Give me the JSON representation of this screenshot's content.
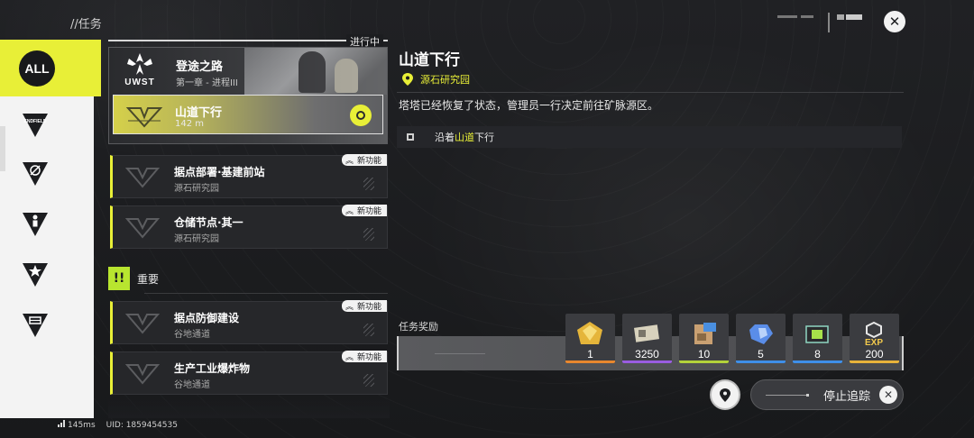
{
  "header": {
    "title": "//任务",
    "close_icon": "close-icon"
  },
  "sidebar": {
    "items": [
      {
        "label": "ALL",
        "icon": "all-icon",
        "active": true
      },
      {
        "label": "ENDFIELD",
        "icon": "endfield-icon"
      },
      {
        "label": "",
        "icon": "compass-icon"
      },
      {
        "label": "",
        "icon": "person-icon"
      },
      {
        "label": "",
        "icon": "star-icon"
      },
      {
        "label": "",
        "icon": "vehicle-icon"
      }
    ]
  },
  "footer": {
    "ping": "145ms",
    "uid": "UID: 1859454535"
  },
  "task_list": {
    "status_tag": "进行中",
    "featured": {
      "logo_text": "UWST",
      "title": "登途之路",
      "subtitle": "第一章 - 进程III",
      "selected_task": {
        "name": "山道下行",
        "distance": "142 m"
      }
    },
    "cards": [
      {
        "name": "据点部署·基建前站",
        "location": "源石研究园",
        "tag": "新功能"
      },
      {
        "name": "仓储节点·其一",
        "location": "源石研究园",
        "tag": "新功能"
      }
    ],
    "section_important": {
      "badge": "!!",
      "label": "重要"
    },
    "important_cards": [
      {
        "name": "据点防御建设",
        "location": "谷地通道",
        "tag": "新功能"
      },
      {
        "name": "生产工业爆炸物",
        "location": "谷地通道",
        "tag": "新功能"
      }
    ]
  },
  "detail": {
    "title": "山道下行",
    "location": "源石研究园",
    "description": "塔塔已经恢复了状态，管理员一行决定前往矿脉源区。",
    "objective": {
      "prefix": "沿着",
      "highlight": "山道",
      "suffix": "下行"
    },
    "reward_label": "任务奖励",
    "rewards": [
      {
        "icon": "gold-crystal-icon",
        "count": "1",
        "color": "#e8872e"
      },
      {
        "icon": "currency-card-icon",
        "count": "3250",
        "color": "#9a5de0"
      },
      {
        "icon": "material-box-icon",
        "count": "10",
        "color": "#b3d23a"
      },
      {
        "icon": "blue-gem-icon",
        "count": "5",
        "color": "#3f8fe8"
      },
      {
        "icon": "device-part-icon",
        "count": "8",
        "color": "#3f8fe8"
      },
      {
        "icon": "exp-icon",
        "count": "200",
        "label": "EXP",
        "color": "#e8b33a"
      }
    ],
    "stop_tracking": "停止追踪"
  }
}
